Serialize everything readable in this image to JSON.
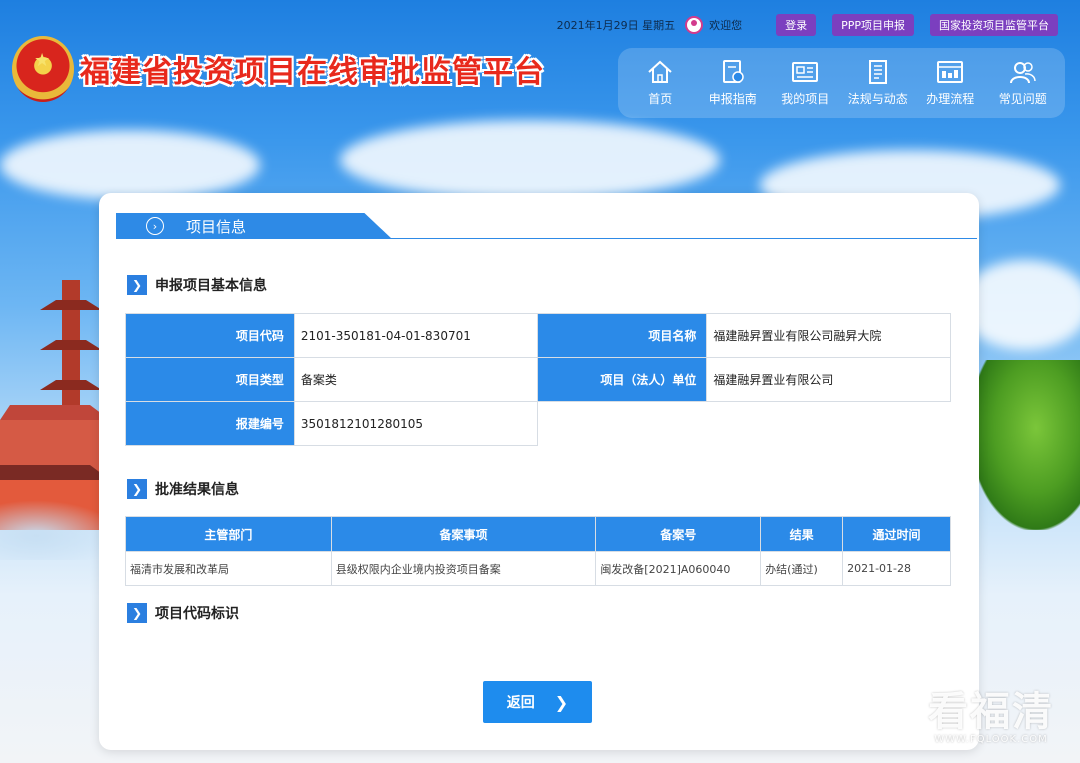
{
  "header": {
    "date": "2021年1月29日 星期五",
    "welcome": "欢迎您",
    "buttons": [
      "登录",
      "PPP项目申报",
      "国家投资项目监管平台"
    ],
    "site_title": "福建省投资项目在线审批监管平台"
  },
  "nav": [
    {
      "label": "首页",
      "icon": "home-icon"
    },
    {
      "label": "申报指南",
      "icon": "guide-icon"
    },
    {
      "label": "我的项目",
      "icon": "project-icon"
    },
    {
      "label": "法规与动态",
      "icon": "law-icon"
    },
    {
      "label": "办理流程",
      "icon": "process-icon"
    },
    {
      "label": "常见问题",
      "icon": "faq-icon"
    }
  ],
  "card": {
    "tab_title": "项目信息",
    "section1": "申报项目基本信息",
    "section2": "批准结果信息",
    "section3": "项目代码标识",
    "info": {
      "code_label": "项目代码",
      "code_value": "2101-350181-04-01-830701",
      "name_label": "项目名称",
      "name_value": "福建融昇置业有限公司融昇大院",
      "type_label": "项目类型",
      "type_value": "备案类",
      "unit_label": "项目（法人）单位",
      "unit_value": "福建融昇置业有限公司",
      "report_label": "报建编号",
      "report_value": "3501812101280105"
    },
    "result": {
      "headers": [
        "主管部门",
        "备案事项",
        "备案号",
        "结果",
        "通过时间"
      ],
      "row": [
        "福清市发展和改革局",
        "县级权限内企业境内投资项目备案",
        "闽发改备[2021]A060040",
        "办结(通过)",
        "2021-01-28"
      ]
    },
    "back_label": "返回"
  },
  "watermark": {
    "main": "看福清",
    "sub": "WWW.FQLOOK.COM"
  },
  "colors": {
    "primary": "#2b8ae8",
    "button_purple": "#7b3fbf",
    "title_red": "#e8291c"
  }
}
